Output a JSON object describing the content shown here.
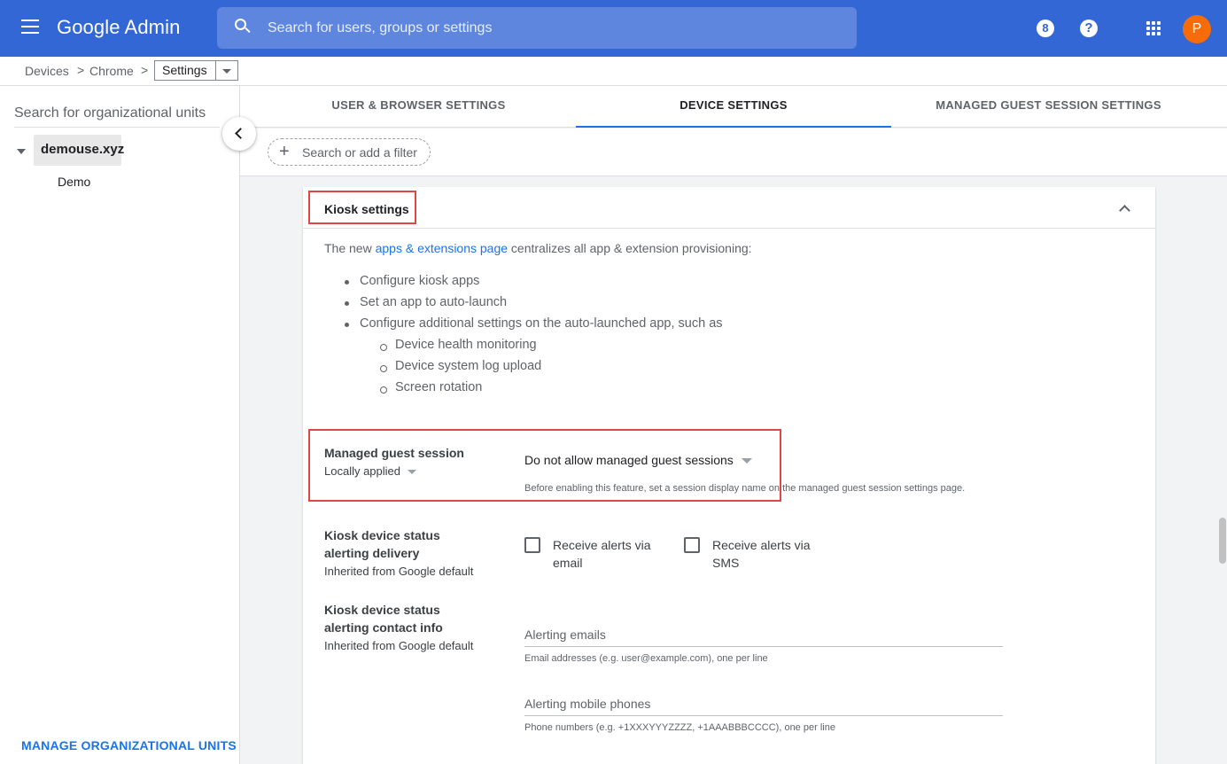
{
  "header": {
    "logo": "Google Admin",
    "search_placeholder": "Search for users, groups or settings",
    "notifications_count": "8",
    "help_glyph": "?",
    "avatar_initial": "P",
    "avatar_color": "#f76c08",
    "brand_color": "#3367d6"
  },
  "breadcrumb": {
    "items": [
      "Devices",
      "Chrome"
    ],
    "separator": ">",
    "current": "Settings"
  },
  "sidebar": {
    "search_placeholder": "Search for organizational units",
    "root": "demouse.xyz",
    "children": [
      "Demo"
    ],
    "manage_link": "MANAGE ORGANIZATIONAL UNITS"
  },
  "tabs": [
    {
      "label": "USER & BROWSER SETTINGS",
      "active": false
    },
    {
      "label": "DEVICE SETTINGS",
      "active": true
    },
    {
      "label": "MANAGED GUEST SESSION SETTINGS",
      "active": false
    }
  ],
  "filter": {
    "plus": "+",
    "placeholder": "Search or add a filter"
  },
  "card": {
    "title": "Kiosk settings",
    "intro_prefix": "The new ",
    "intro_link": "apps & extensions page",
    "intro_suffix": " centralizes all app & extension provisioning:",
    "bullets": [
      "Configure kiosk apps",
      "Set an app to auto-launch",
      "Configure additional settings on the auto-launched app, such as"
    ],
    "sub_bullets": [
      "Device health monitoring",
      "Device system log upload",
      "Screen rotation"
    ],
    "managed_guest": {
      "label": "Managed guest session",
      "status": "Locally applied",
      "value": "Do not allow managed guest sessions",
      "helper": "Before enabling this feature, set a session display name on the managed guest session settings page."
    },
    "alert_delivery": {
      "label": "Kiosk device status alerting delivery",
      "status": "Inherited from Google default",
      "email_label": "Receive alerts via email",
      "sms_label": "Receive alerts via SMS"
    },
    "alert_contact": {
      "label": "Kiosk device status alerting contact info",
      "status": "Inherited from Google default",
      "emails_placeholder": "Alerting emails",
      "emails_helper": "Email addresses (e.g. user@example.com), one per line",
      "phones_placeholder": "Alerting mobile phones",
      "phones_helper": "Phone numbers (e.g. +1XXXYYYZZZZ, +1AAABBBCCCC), one per line"
    }
  }
}
